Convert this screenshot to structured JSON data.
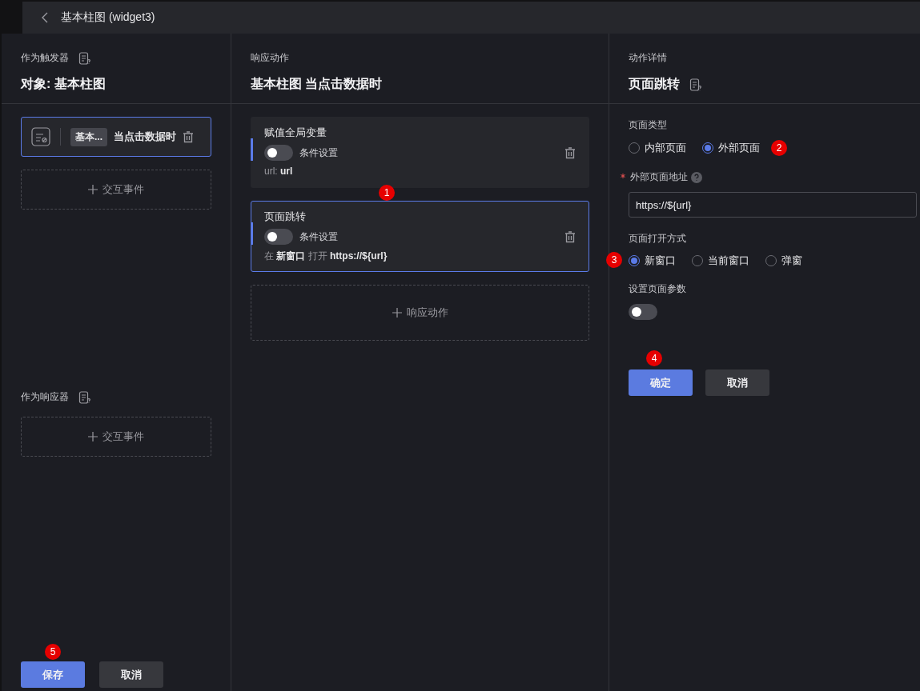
{
  "header": {
    "title": "基本柱图 (widget3)"
  },
  "trigger": {
    "label": "作为触发器",
    "title": "对象: 基本柱图",
    "event": {
      "tag": "基本...",
      "text": "当点击数据时",
      "selected": true
    },
    "add": "交互事件"
  },
  "responder": {
    "label": "作为响应器",
    "add": "交互事件"
  },
  "footer": {
    "badge": "5",
    "buttons": [
      {
        "label": "保存",
        "kind": "primary"
      },
      {
        "label": "取消",
        "kind": "secondary"
      }
    ]
  },
  "actions_panel": {
    "label": "响应动作",
    "title": "基本柱图 当点击数据时",
    "add": "响应动作",
    "actions": [
      {
        "title": "赋值全局变量",
        "toggle_label": "条件设置",
        "on": false,
        "selected": false,
        "badge": "1",
        "detail": [
          {
            "text": "url:",
            "strong": false
          },
          {
            "text": "url",
            "strong": true
          }
        ]
      },
      {
        "title": "页面跳转",
        "toggle_label": "条件设置",
        "on": false,
        "selected": true,
        "detail": [
          {
            "text": "在",
            "strong": false
          },
          {
            "text": "新窗口",
            "strong": true
          },
          {
            "text": "打开",
            "strong": false
          },
          {
            "text": "https://${url}",
            "strong": true
          }
        ]
      }
    ]
  },
  "details": {
    "label": "动作详情",
    "title": "页面跳转",
    "page_type": {
      "label": "页面类型",
      "badge": "2",
      "options": [
        {
          "label": "内部页面",
          "selected": false
        },
        {
          "label": "外部页面",
          "selected": true
        }
      ]
    },
    "address": {
      "label": "外部页面地址",
      "required": true,
      "value": "https://${url}"
    },
    "open_mode": {
      "label": "页面打开方式",
      "badge": "3",
      "options": [
        {
          "label": "新窗口",
          "selected": true
        },
        {
          "label": "当前窗口",
          "selected": false
        },
        {
          "label": "弹窗",
          "selected": false
        }
      ]
    },
    "params": {
      "label": "设置页面参数",
      "on": false
    },
    "badge": "4",
    "buttons": [
      {
        "label": "确定",
        "kind": "primary"
      },
      {
        "label": "取消",
        "kind": "secondary"
      }
    ]
  }
}
